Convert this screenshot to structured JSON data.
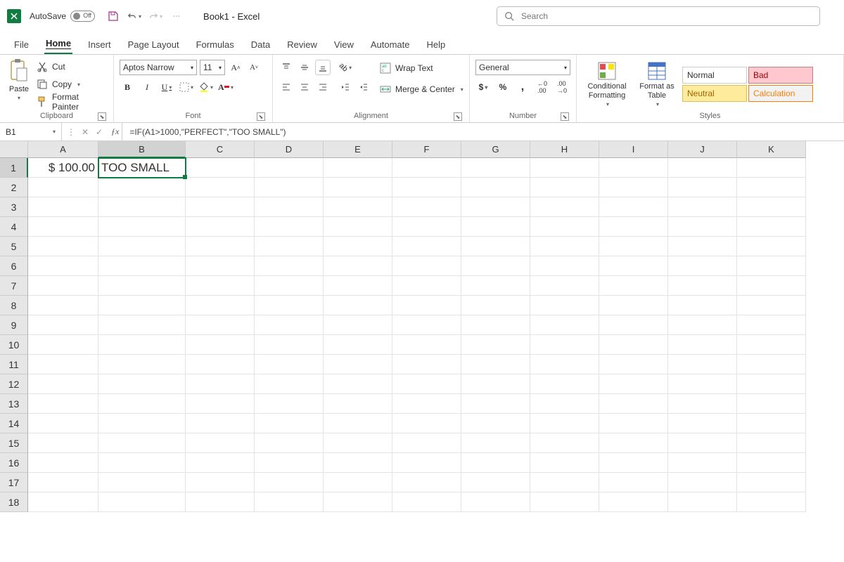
{
  "titlebar": {
    "autosave_label": "AutoSave",
    "autosave_state": "Off",
    "doc_title": "Book1 - Excel",
    "search_placeholder": "Search"
  },
  "tabs": [
    "File",
    "Home",
    "Insert",
    "Page Layout",
    "Formulas",
    "Data",
    "Review",
    "View",
    "Automate",
    "Help"
  ],
  "active_tab": "Home",
  "ribbon": {
    "clipboard": {
      "paste": "Paste",
      "cut": "Cut",
      "copy": "Copy",
      "format_painter": "Format Painter",
      "label": "Clipboard"
    },
    "font": {
      "name": "Aptos Narrow",
      "size": "11",
      "label": "Font"
    },
    "alignment": {
      "wrap": "Wrap Text",
      "merge": "Merge & Center",
      "label": "Alignment"
    },
    "number": {
      "format": "General",
      "label": "Number"
    },
    "styles": {
      "cond_fmt": "Conditional Formatting",
      "fmt_table": "Format as Table",
      "normal": "Normal",
      "bad": "Bad",
      "neutral": "Neutral",
      "calc": "Calculation",
      "label": "Styles"
    }
  },
  "namebox": "B1",
  "formula": "=IF(A1>1000,\"PERFECT\",\"TOO SMALL\")",
  "columns": [
    "A",
    "B",
    "C",
    "D",
    "E",
    "F",
    "G",
    "H",
    "I",
    "J",
    "K"
  ],
  "selected_col": "B",
  "selected_row": 1,
  "row_count": 18,
  "cells": {
    "A1": "$ 100.00",
    "B1": "TOO SMALL"
  }
}
